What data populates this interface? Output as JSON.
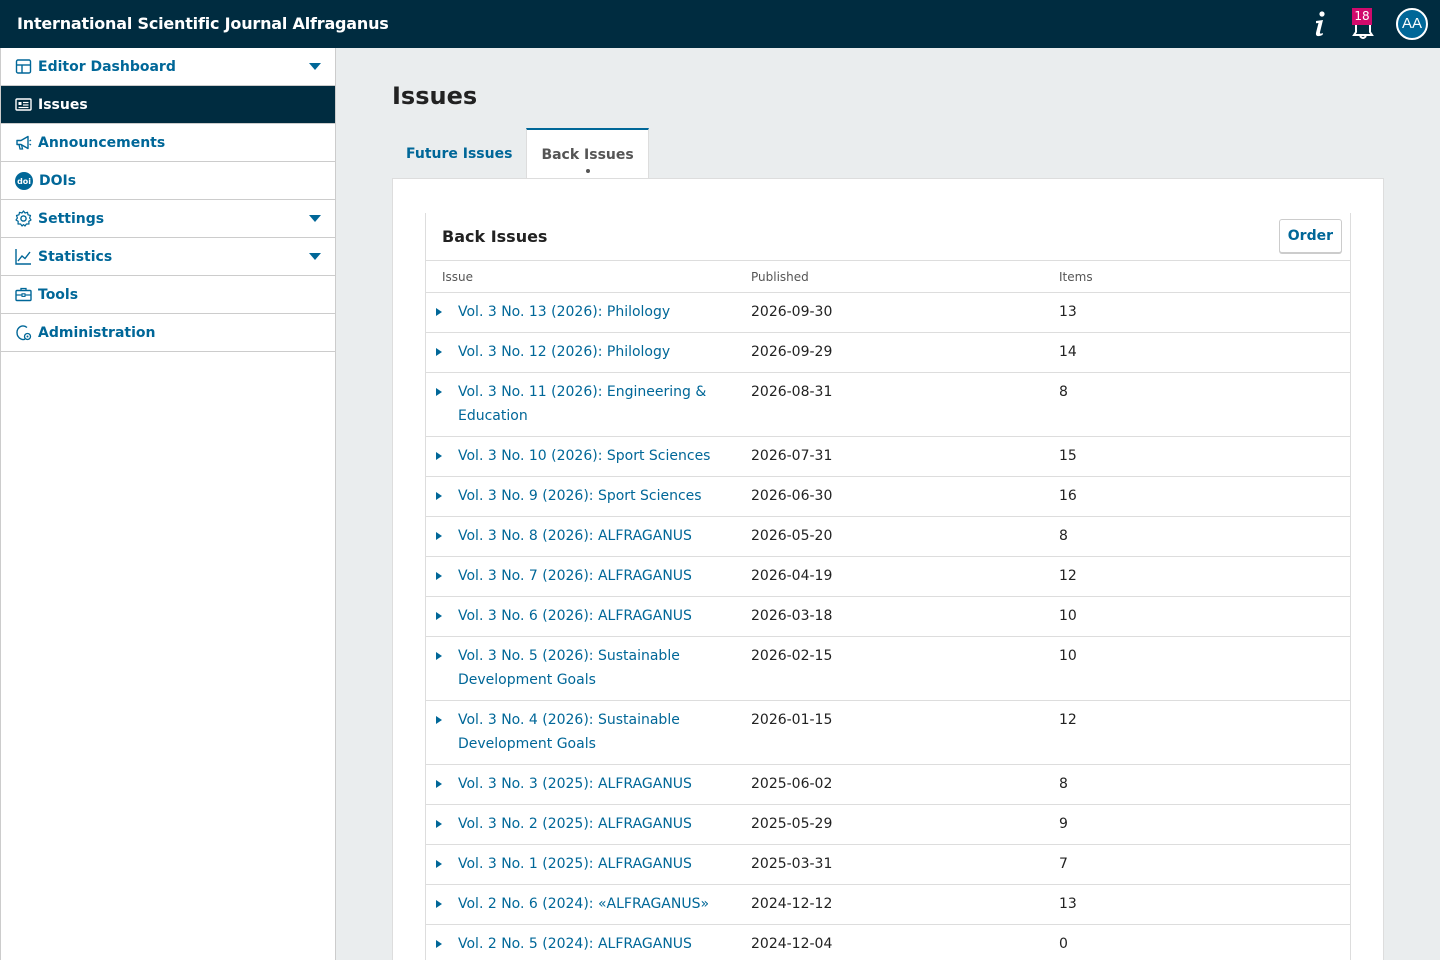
{
  "header": {
    "journal_title": "International Scientific Journal Alfraganus",
    "notifications_count": "18",
    "avatar_initials": "AA",
    "accent": "#006798",
    "bar_color": "#002c40",
    "badge_color": "#d00a6c"
  },
  "sidebar": {
    "items": [
      {
        "label": "Editor Dashboard",
        "icon": "dashboard-icon"
      },
      {
        "label": "Issues",
        "icon": "issues-icon"
      },
      {
        "label": "Announcements",
        "icon": "megaphone-icon"
      },
      {
        "label": "DOIs",
        "icon": "doi-icon"
      },
      {
        "label": "Settings",
        "icon": "gear-icon"
      },
      {
        "label": "Statistics",
        "icon": "chart-icon"
      },
      {
        "label": "Tools",
        "icon": "toolbox-icon"
      },
      {
        "label": "Administration",
        "icon": "admin-icon"
      }
    ]
  },
  "main": {
    "page_title": "Issues",
    "tabs": [
      {
        "label": "Future Issues"
      },
      {
        "label": "Back Issues"
      }
    ],
    "list": {
      "title": "Back Issues",
      "order_label": "Order",
      "columns": {
        "issue": "Issue",
        "published": "Published",
        "items": "Items"
      },
      "rows": [
        {
          "issue": "Vol. 3 No. 13 (2026): Philology",
          "published": "2026-09-30",
          "items": "13"
        },
        {
          "issue": "Vol. 3 No. 12 (2026): Philology",
          "published": "2026-09-29",
          "items": "14"
        },
        {
          "issue": "Vol. 3 No. 11 (2026): Engineering & Education",
          "published": "2026-08-31",
          "items": "8"
        },
        {
          "issue": "Vol. 3 No. 10 (2026): Sport Sciences",
          "published": "2026-07-31",
          "items": "15"
        },
        {
          "issue": "Vol. 3 No. 9 (2026): Sport Sciences",
          "published": "2026-06-30",
          "items": "16"
        },
        {
          "issue": "Vol. 3 No. 8 (2026): ALFRAGANUS",
          "published": "2026-05-20",
          "items": "8"
        },
        {
          "issue": "Vol. 3 No. 7 (2026): ALFRAGANUS",
          "published": "2026-04-19",
          "items": "12"
        },
        {
          "issue": "Vol. 3 No. 6 (2026): ALFRAGANUS",
          "published": "2026-03-18",
          "items": "10"
        },
        {
          "issue": "Vol. 3 No. 5 (2026): Sustainable Development Goals",
          "published": "2026-02-15",
          "items": "10"
        },
        {
          "issue": "Vol. 3 No. 4 (2026): Sustainable Development Goals",
          "published": "2026-01-15",
          "items": "12"
        },
        {
          "issue": "Vol. 3 No. 3 (2025): ALFRAGANUS",
          "published": "2025-06-02",
          "items": "8"
        },
        {
          "issue": "Vol. 3 No. 2 (2025): ALFRAGANUS",
          "published": "2025-05-29",
          "items": "9"
        },
        {
          "issue": "Vol. 3 No. 1 (2025): ALFRAGANUS",
          "published": "2025-03-31",
          "items": "7"
        },
        {
          "issue": "Vol. 2 No. 6 (2024): «ALFRAGANUS»",
          "published": "2024-12-12",
          "items": "13"
        },
        {
          "issue": "Vol. 2 No. 5 (2024): ALFRAGANUS",
          "published": "2024-12-04",
          "items": "0"
        }
      ]
    }
  }
}
